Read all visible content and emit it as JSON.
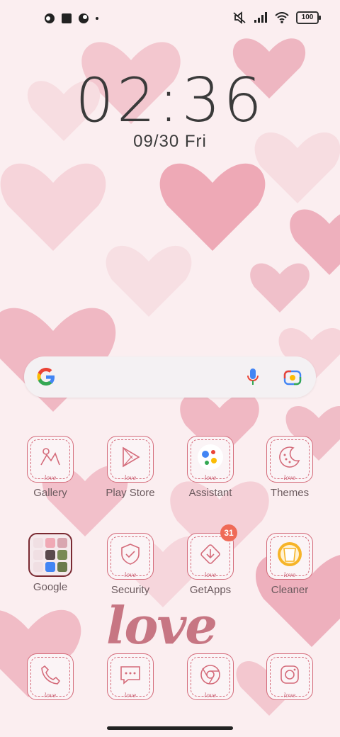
{
  "status_bar": {
    "left_icons": [
      "notification-icon",
      "square-icon",
      "notification-icon"
    ],
    "right_icons": [
      "mute-icon",
      "signal-icon",
      "wifi-icon"
    ],
    "battery": "100"
  },
  "clock": {
    "time": "02:36",
    "date": "09/30 Fri"
  },
  "search": {
    "icons": [
      "google-g-icon",
      "mic-icon",
      "lens-icon"
    ]
  },
  "apps": {
    "gallery": "Gallery",
    "play_store": "Play Store",
    "assistant": "Assistant",
    "themes": "Themes",
    "google": "Google",
    "security": "Security",
    "getapps": "GetApps",
    "getapps_badge": "31",
    "cleaner": "Cleaner"
  },
  "dock": [
    "phone-icon",
    "messages-icon",
    "chrome-icon",
    "camera-icon"
  ],
  "icon_sticker": "love",
  "wallpaper_text": "love",
  "colors": {
    "accent": "#d46b7a",
    "background": "#fbeef0",
    "badge": "#ef6a57"
  }
}
